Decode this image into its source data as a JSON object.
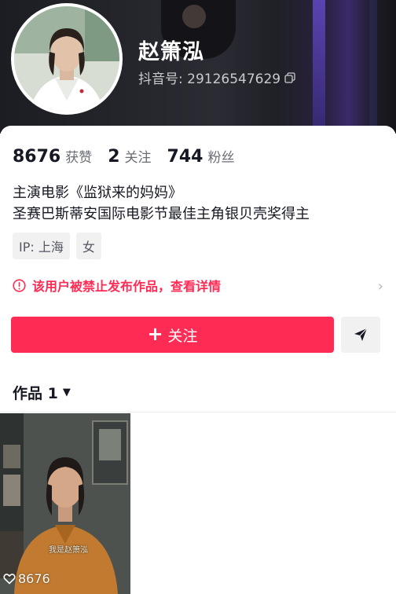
{
  "profile": {
    "name": "赵箫泓",
    "douyin_id": "抖音号: 29126547629",
    "bio_line1": "主演电影《监狱来的妈妈》",
    "bio_line2": "圣赛巴斯蒂安国际电影节最佳主角银贝壳奖得主",
    "tags": [
      "IP: 上海",
      "女"
    ]
  },
  "stats": {
    "likes_num": "8676",
    "likes_label": "获赞",
    "following_num": "2",
    "following_label": "关注",
    "followers_num": "744",
    "followers_label": "粉丝"
  },
  "notice": {
    "text": "该用户被禁止发布作品，查看详情",
    "chevron": "›"
  },
  "actions": {
    "follow_plus": "+",
    "follow_label": "关注"
  },
  "works": {
    "tab_label": "作品 1",
    "caret": "▼",
    "items": [
      {
        "likes": "8676",
        "caption": "我是赵箫泓"
      }
    ]
  },
  "colors": {
    "accent": "#fe2c55",
    "text": "#161823",
    "secondary": "#6b6d74"
  },
  "icons": {
    "copy": "copy-icon",
    "warning": "warning-circle-icon",
    "share": "paper-plane-icon",
    "heart": "heart-outline-icon"
  }
}
